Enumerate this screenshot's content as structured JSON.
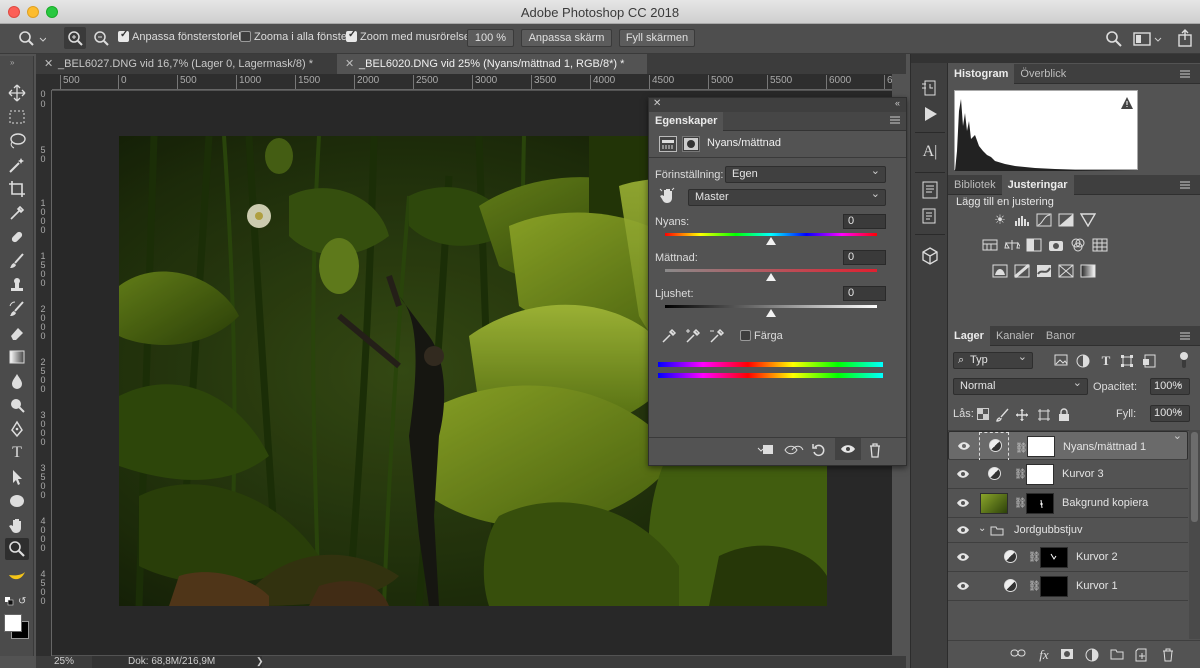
{
  "window": {
    "title": "Adobe Photoshop CC 2018"
  },
  "options": {
    "resize_windows": "Anpassa fönsterstorlek",
    "zoom_all": "Zooma i alla fönster",
    "scrubby_zoom": "Zoom med musrörelse",
    "zoom_value": "100 %",
    "fit_screen": "Anpassa skärm",
    "fill_screen": "Fyll skärmen"
  },
  "tabs": [
    {
      "label": "_BEL6027.DNG vid 16,7% (Lager 0, Lagermask/8) *"
    },
    {
      "label": "_BEL6020.DNG vid 25% (Nyans/mättnad 1, RGB/8*) *"
    }
  ],
  "ruler": {
    "h": [
      "500",
      "0",
      "500",
      "1000",
      "1500",
      "2000",
      "2500",
      "3000",
      "3500",
      "4000",
      "4500",
      "5000",
      "5500",
      "6000",
      "6"
    ],
    "v": [
      "0",
      "0",
      "5",
      "0",
      "1",
      "0",
      "0",
      "0",
      "1",
      "5",
      "0",
      "0",
      "2",
      "0",
      "0",
      "0",
      "2",
      "5",
      "0",
      "0",
      "3",
      "0",
      "0",
      "0",
      "3",
      "5",
      "0",
      "0",
      "4",
      "0",
      "0",
      "0",
      "4",
      "5",
      "0",
      "0"
    ]
  },
  "status": {
    "zoom": "25%",
    "doc": "Dok: 68,8M/216,9M",
    "arrow": "❯"
  },
  "properties": {
    "tab": "Egenskaper",
    "title": "Nyans/mättnad",
    "preset_label": "Förinställning:",
    "preset_value": "Egen",
    "channel_value": "Master",
    "hue_label": "Nyans:",
    "hue_value": "0",
    "sat_label": "Mättnad:",
    "sat_value": "0",
    "light_label": "Ljushet:",
    "light_value": "0",
    "colorize_label": "Färga",
    "hue_pos": 0.5,
    "sat_pos": 0.5,
    "light_pos": 0.5
  },
  "histogram": {
    "tab_active": "Histogram",
    "tab_other": "Överblick"
  },
  "adjustments": {
    "tab_other": "Bibliotek",
    "tab_active": "Justeringar",
    "add_label": "Lägg till en justering"
  },
  "layers_panel": {
    "tabs": [
      "Lager",
      "Kanaler",
      "Banor"
    ],
    "filter_value": "Typ",
    "blend_mode": "Normal",
    "opacity_label": "Opacitet:",
    "opacity_value": "100%",
    "lock_label": "Lås:",
    "fill_label": "Fyll:",
    "fill_value": "100%",
    "layers": [
      {
        "name": "Nyans/mättnad 1"
      },
      {
        "name": "Kurvor 3"
      },
      {
        "name": "Bakgrund kopiera"
      },
      {
        "name": "Jordgubbstjuv"
      },
      {
        "name": "Kurvor 2"
      },
      {
        "name": "Kurvor 1"
      }
    ]
  },
  "colors": {
    "accent": "#4a90e2",
    "panel": "#535353",
    "canvas_bg": "#282828"
  }
}
